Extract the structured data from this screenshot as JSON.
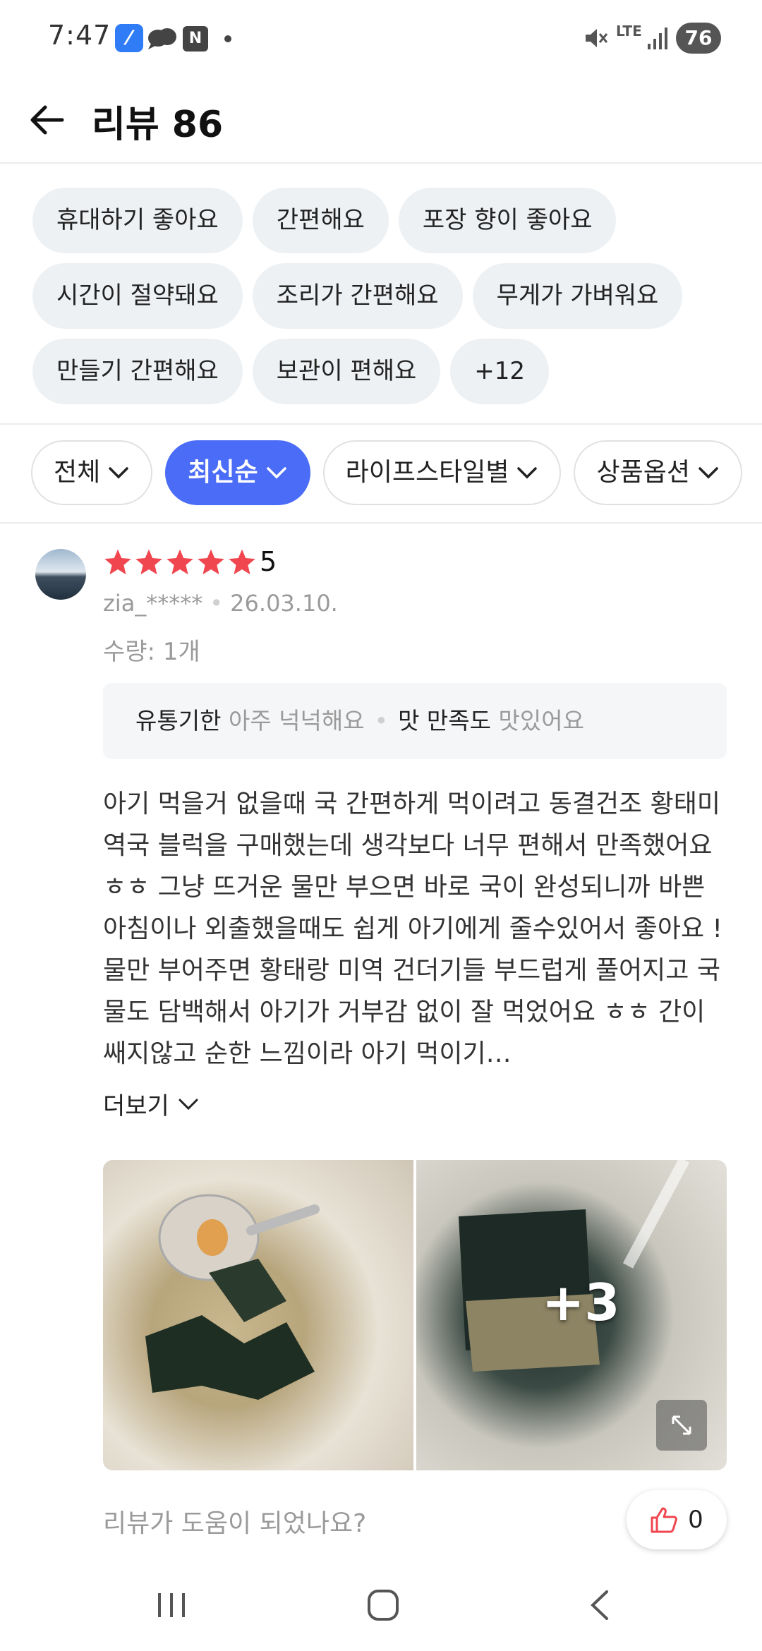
{
  "status_bar": {
    "time": "7:47",
    "network": "LTE",
    "battery": "76",
    "icons": [
      "toss-app-icon",
      "cloud-chat-icon",
      "n-app-icon",
      "notification-dot",
      "mute-icon",
      "signal-icon",
      "battery-icon"
    ]
  },
  "header": {
    "title": "리뷰 86",
    "back_icon": "arrow-left-icon"
  },
  "keywords": {
    "rows": [
      [
        "휴대하기 좋아요",
        "간편해요",
        "포장 향이 좋아요"
      ],
      [
        "시간이 절약돼요",
        "조리가 간편해요",
        "무게가 가벼워요"
      ],
      [
        "만들기 간편해요",
        "보관이 편해요",
        "+12"
      ]
    ]
  },
  "filters": {
    "all": "전체",
    "latest": "최신순",
    "lifestyle": "라이프스타일별",
    "option": "상품옵션"
  },
  "colors": {
    "accent": "#4a6cf7",
    "star": "#f0464f",
    "muted": "#9a9a9a",
    "chip_bg": "#eef1f4"
  },
  "review": {
    "stars": 5,
    "rating": "5",
    "author": "zia_*****",
    "date": "26.03.10.",
    "quantity": "수량: 1개",
    "attr1_key": "유통기한",
    "attr1_val": "아주 넉넉해요",
    "attr2_key": "맛 만족도",
    "attr2_val": "맛있어요",
    "body": "아기 먹을거 없을때 국 간편하게 먹이려고 동결건조 황태미역국 블럭을 구매했는데 생각보다 너무 편해서 만족했어요 ㅎㅎ 그냥 뜨거운 물만 부으면 바로 국이 완성되니까 바쁜 아침이나 외출했을때도 쉽게 아기에게 줄수있어서 좋아요 ! 물만 부어주면 황태랑 미역 건더기들 부드럽게 풀어지고 국물도 담백해서 아기가 거부감 없이 잘 먹었어요 ㅎㅎ 간이 쌔지않고 순한 느낌이라 아기 먹이기…",
    "more_label": "더보기",
    "photo_more": "+3",
    "helpful_question": "리뷰가 도움이 되었나요?",
    "like_count": "0"
  },
  "nav": {
    "recent": "recent-apps-icon",
    "home": "home-icon",
    "back": "back-icon"
  }
}
